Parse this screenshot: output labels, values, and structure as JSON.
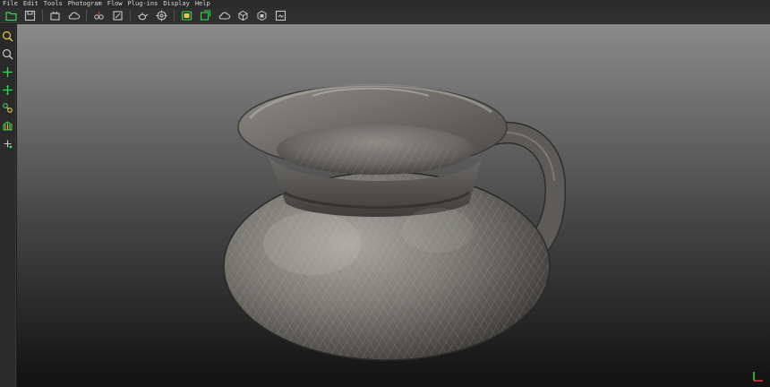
{
  "menu": {
    "items": [
      "File",
      "Edit",
      "Tools",
      "Photogram",
      "Flow",
      "Plug-ins",
      "Display",
      "Help"
    ]
  },
  "toolbar": {
    "groups": [
      [
        "open-folder-icon",
        "save-icon"
      ],
      [
        "capture-icon",
        "cloud-icon"
      ],
      [
        "camera-group-icon",
        "edit-icon"
      ],
      [
        "teapot-icon",
        "target-icon"
      ],
      [
        "calibrate-icon",
        "sync-icon",
        "cloud-outline-icon",
        "cube-icon",
        "cube-alt-icon",
        "frame-icon"
      ]
    ]
  },
  "leftbar": {
    "tools": [
      "zoom-fit-icon",
      "zoom-icon",
      "pan-icon",
      "move-icon",
      "link-icon",
      "grid-icon",
      "move-small-icon"
    ]
  },
  "colors": {
    "accent_green": "#39d353",
    "accent_yellow": "#e2c84a",
    "icon_gray": "#c8c8c8",
    "axis_red": "#e03b3b",
    "axis_green": "#3fd35a"
  }
}
